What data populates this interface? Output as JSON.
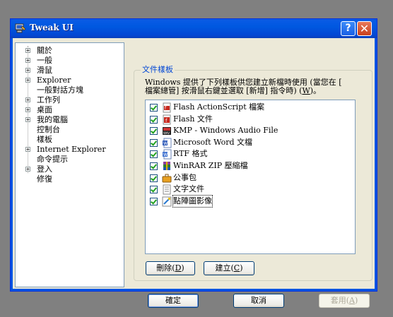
{
  "window": {
    "title": "Tweak UI",
    "help_label": "?",
    "close_label": "✕"
  },
  "tree": {
    "items": [
      {
        "label": "關於",
        "expandable": true
      },
      {
        "label": "一般",
        "expandable": true
      },
      {
        "label": "滑鼠",
        "expandable": true
      },
      {
        "label": "Explorer",
        "expandable": true
      },
      {
        "label": "一般對話方塊",
        "expandable": false
      },
      {
        "label": "工作列",
        "expandable": true
      },
      {
        "label": "桌面",
        "expandable": true
      },
      {
        "label": "我的電腦",
        "expandable": true
      },
      {
        "label": "控制台",
        "expandable": false
      },
      {
        "label": "樣板",
        "expandable": false
      },
      {
        "label": "Internet Explorer",
        "expandable": true
      },
      {
        "label": "命令提示",
        "expandable": false
      },
      {
        "label": "登入",
        "expandable": true
      },
      {
        "label": "修復",
        "expandable": false
      }
    ]
  },
  "templates": {
    "group_title": "文件樣板",
    "description_line1": "Windows 提供了下列樣板供您建立新檔時使用 (當您在 [",
    "description_line2_pre": "檔案總管] 按滑鼠右鍵並選取 [新增] 指令時) (",
    "description_mnemonic": "W",
    "description_line2_post": ")。",
    "items": [
      {
        "label": "Flash ActionScript 檔案",
        "icon": "flash-actionscript-icon",
        "checked": true
      },
      {
        "label": "Flash 文件",
        "icon": "flash-document-icon",
        "checked": true
      },
      {
        "label": "KMP - Windows Audio File",
        "icon": "kmp-audio-icon",
        "checked": true
      },
      {
        "label": "Microsoft Word 文檔",
        "icon": "word-document-icon",
        "checked": true
      },
      {
        "label": "RTF 格式",
        "icon": "rtf-document-icon",
        "checked": true
      },
      {
        "label": "WinRAR ZIP 壓縮檔",
        "icon": "winrar-icon",
        "checked": true
      },
      {
        "label": "公事包",
        "icon": "briefcase-icon",
        "checked": true
      },
      {
        "label": "文字文件",
        "icon": "text-document-icon",
        "checked": true
      },
      {
        "label": "點陣圖影像",
        "icon": "bitmap-image-icon",
        "checked": true
      }
    ],
    "delete_label": "刪除",
    "delete_mnemonic": "D",
    "create_label": "建立",
    "create_mnemonic": "C"
  },
  "footer": {
    "ok_label": "確定",
    "cancel_label": "取消",
    "apply_label": "套用",
    "apply_mnemonic": "A"
  }
}
